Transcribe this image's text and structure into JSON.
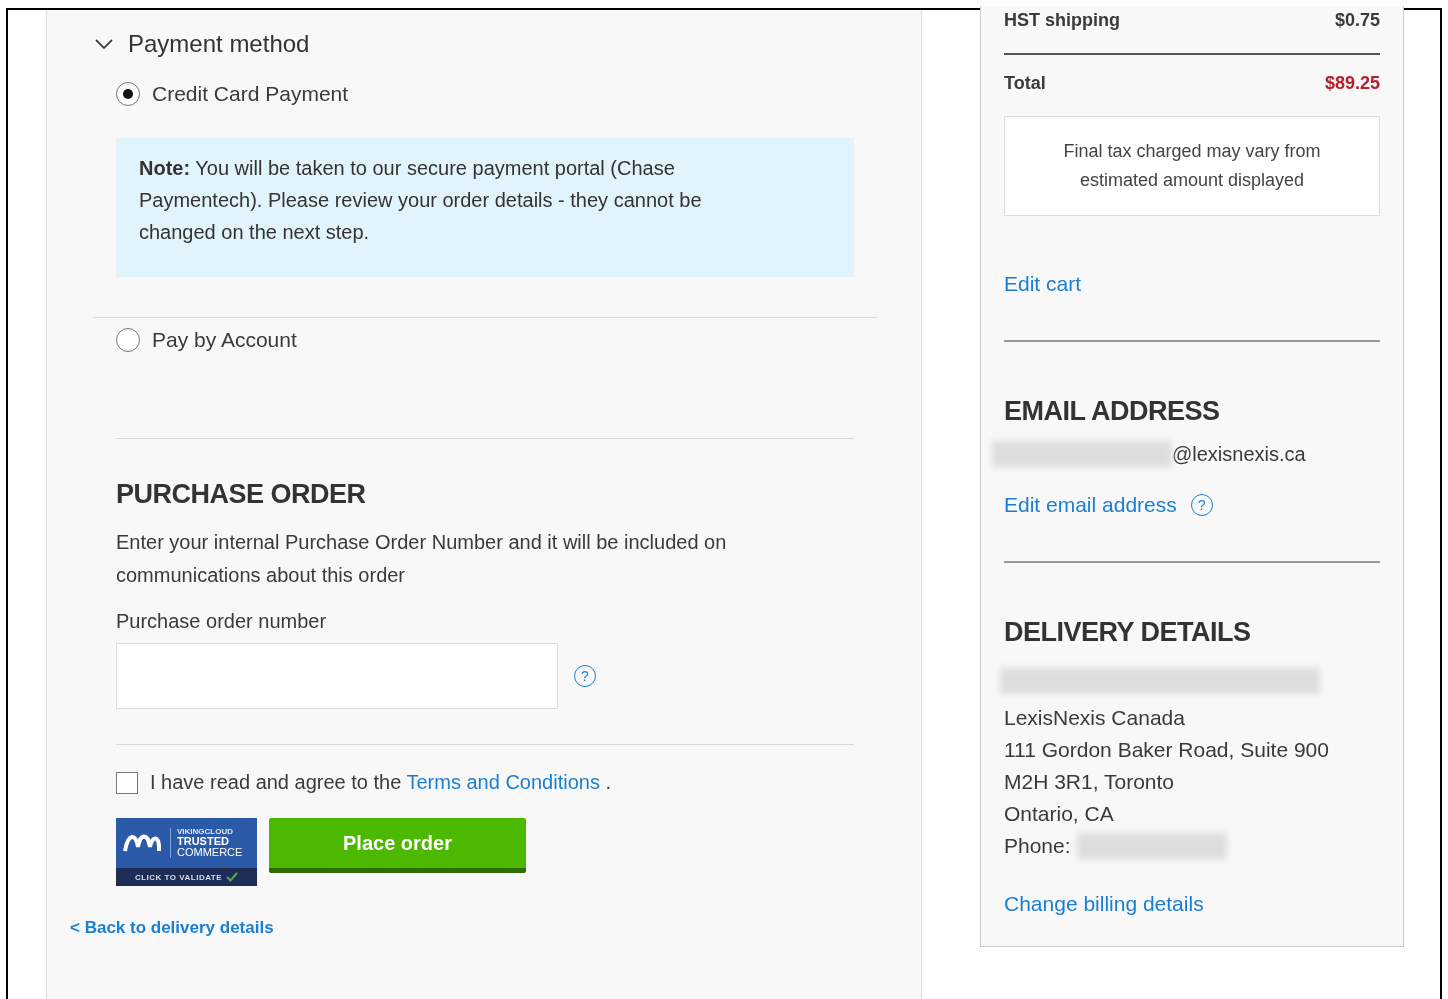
{
  "payment_method": {
    "heading": "Payment method",
    "expanded": true,
    "options": [
      {
        "label": "Credit Card Payment",
        "selected": true,
        "note": "**Note:** You will be taken to our secure payment portal (Chase Paymentech). Please review your order details - they cannot be changed on the next step."
      },
      {
        "label": "Pay by Account",
        "selected": false
      }
    ]
  },
  "purchase_order": {
    "heading": "PURCHASE ORDER",
    "description": "Enter your internal Purchase Order Number and it will be included on communications about this order",
    "field_label": "Purchase order number",
    "help_icon": "?"
  },
  "terms": {
    "checked": false,
    "text": "I have read and agree to the",
    "link": "Terms and Conditions",
    "suffix": "."
  },
  "trust_badge": {
    "brand": "VIKINGCLOUD",
    "line1": "TRUSTED",
    "line2": "COMMERCE",
    "footer": "CLICK TO VALIDATE"
  },
  "place_order_button": "Place order",
  "back_link": "< Back to delivery details",
  "summary": {
    "rows": [
      {
        "label": "HST shipping",
        "value": "$0.75",
        "kind": "line"
      },
      {
        "label": "Total",
        "value": "$89.25",
        "kind": "total"
      }
    ],
    "tax_note": "Final tax charged may vary from estimated amount displayed",
    "edit_cart": "Edit cart"
  },
  "email": {
    "heading": "EMAIL ADDRESS",
    "address": "@lexisnexis.ca",
    "edit_link": "Edit email address",
    "help_icon": "?"
  },
  "delivery": {
    "heading": "DELIVERY DETAILS",
    "lines": [
      "LexisNexis Canada",
      "111 Gordon Baker Road, Suite 900",
      "M2H 3R1, Toronto",
      "Ontario, CA"
    ],
    "phone_label": "Phone:",
    "change_link": "Change billing details"
  }
}
